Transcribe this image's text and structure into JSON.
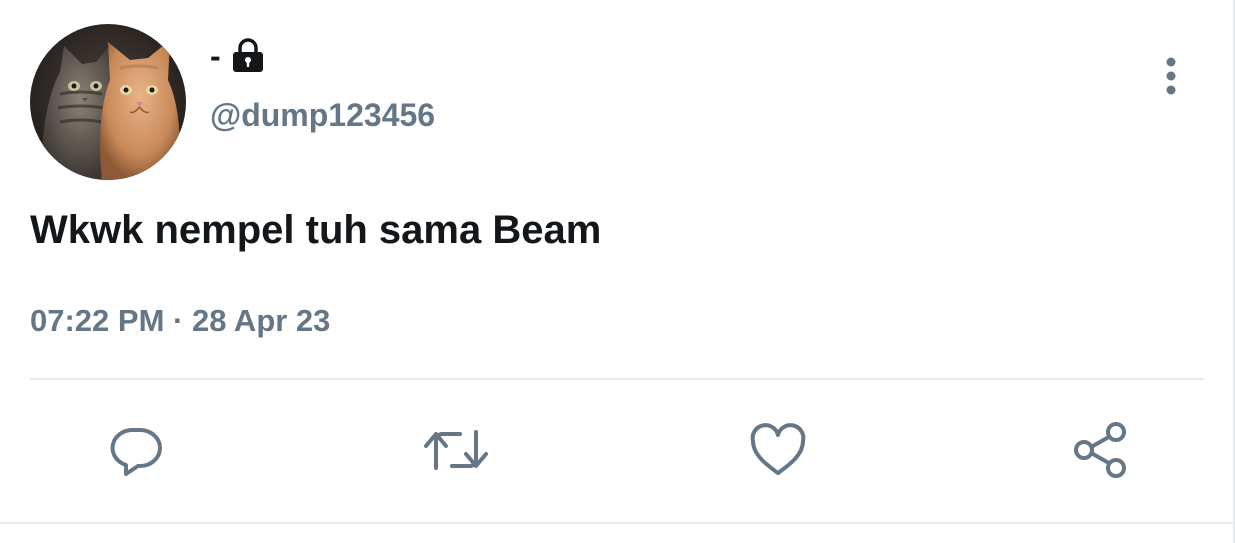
{
  "tweet": {
    "display_name": "-",
    "handle": "@dump123456",
    "text": "Wkwk nempel tuh sama Beam",
    "time": "07:22 PM",
    "separator": "·",
    "date": "28 Apr 23",
    "protected": true
  },
  "icons": {
    "lock": "lock-icon",
    "more": "more-vertical-icon",
    "reply": "reply-icon",
    "retweet": "retweet-icon",
    "like": "heart-icon",
    "share": "share-icon"
  },
  "colors": {
    "text_primary": "#14171a",
    "text_secondary": "#657786",
    "divider": "#e6e9ec"
  }
}
